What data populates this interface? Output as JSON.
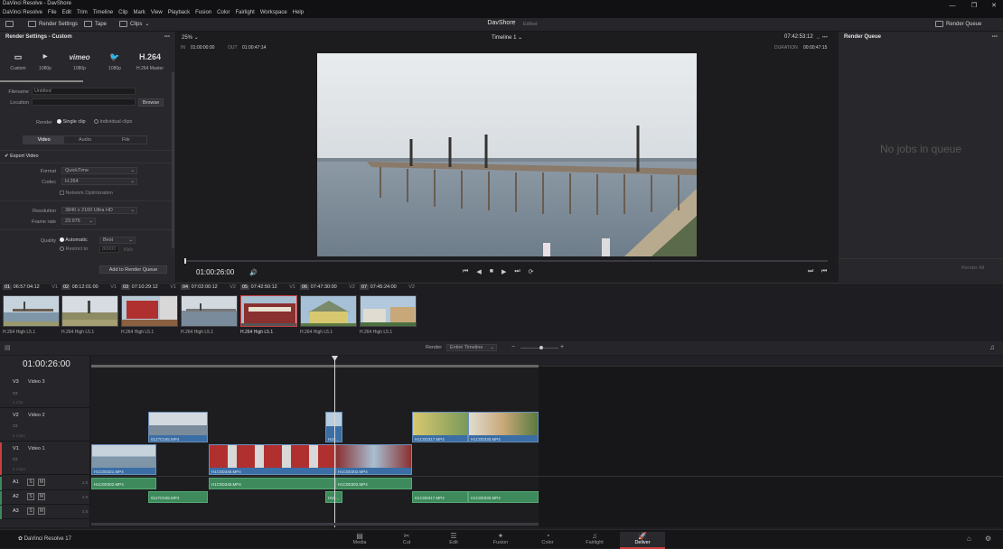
{
  "app": {
    "title": "DaVinci Resolve - DavShore",
    "menus": [
      "DaVinci Resolve",
      "File",
      "Edit",
      "Trim",
      "Timeline",
      "Clip",
      "Mark",
      "View",
      "Playback",
      "Fusion",
      "Color",
      "Fairlight",
      "Workspace",
      "Help"
    ]
  },
  "toolbar": {
    "render_settings": "Render Settings",
    "tape": "Tape",
    "clips": "Clips",
    "project": "DavShore",
    "edited": "Edited",
    "render_queue": "Render Queue"
  },
  "render_settings": {
    "title": "Render Settings - Custom",
    "more": "•••",
    "presets": [
      {
        "icon": "▭",
        "label": "Custom"
      },
      {
        "icon": "▶",
        "label": "1080p"
      },
      {
        "icon": "vimeo",
        "label": "1080p"
      },
      {
        "icon": "🐦",
        "label": "1080p"
      },
      {
        "icon": "H.264",
        "label": "H.264 Master"
      }
    ],
    "filename_label": "Filename",
    "filename": "Untitled",
    "location_label": "Location",
    "browse": "Browse",
    "render_label": "Render",
    "single_clip": "Single clip",
    "individual_clips": "Individual clips",
    "tabs": [
      "Video",
      "Audio",
      "File"
    ],
    "export_video": "Export Video",
    "format_label": "Format",
    "format": "QuickTime",
    "codec_label": "Codec",
    "codec": "H.264",
    "network_opt": "Network Optimization",
    "resolution_label": "Resolution",
    "resolution": "3840 x 2160 Ultra HD",
    "framerate_label": "Frame rate",
    "framerate": "23.976",
    "quality_label": "Quality",
    "automatic": "Automatic",
    "best": "Best",
    "restrict": "Restrict to",
    "restrict_val": "80000",
    "kbs": "Kb/s",
    "add_queue": "Add to Render Queue"
  },
  "viewer": {
    "zoom": "25%",
    "timeline": "Timeline 1",
    "timecode_top": "07:42:53:12",
    "in_label": "IN",
    "in": "01:00:00:00",
    "out_label": "OUT",
    "out": "01:00:47:14",
    "duration_label": "DURATION",
    "duration": "00:00:47:15",
    "timecode": "01:00:26:00"
  },
  "render_queue": {
    "title": "Render Queue",
    "empty": "No jobs in queue",
    "render_all": "Render All"
  },
  "clips": [
    {
      "num": "01",
      "tc": "06:57:04:12",
      "track": "V1",
      "name": "H.264 High L5.1"
    },
    {
      "num": "02",
      "tc": "08:12:01:00",
      "track": "V1",
      "name": "H.264 High L5.1"
    },
    {
      "num": "03",
      "tc": "07:10:29:12",
      "track": "V1",
      "name": "H.264 High L5.1"
    },
    {
      "num": "04",
      "tc": "07:02:00:12",
      "track": "V2",
      "name": "H.264 High L5.1"
    },
    {
      "num": "05",
      "tc": "07:42:50:12",
      "track": "V1",
      "name": "H.264 High L5.1"
    },
    {
      "num": "06",
      "tc": "07:47:30:00",
      "track": "V2",
      "name": "H.264 High L5.1"
    },
    {
      "num": "07",
      "tc": "07:45:24:00",
      "track": "V2",
      "name": "H.264 High L5.1"
    }
  ],
  "timeline": {
    "render_label": "Render",
    "render_value": "Entire Timeline",
    "timecode": "01:00:26:00",
    "tracks": [
      {
        "id": "V3",
        "name": "Video 3",
        "info": "0 Clip"
      },
      {
        "id": "V2",
        "name": "Video 2",
        "info": "5 Clips"
      },
      {
        "id": "V1",
        "name": "Video 1",
        "info": "5 Clips"
      }
    ],
    "audio": [
      {
        "id": "A1",
        "s": "S",
        "m": "M",
        "ch": "2.0"
      },
      {
        "id": "A2",
        "s": "S",
        "m": "M",
        "ch": "2.0"
      },
      {
        "id": "A3",
        "s": "S",
        "m": "M",
        "ch": "2.0"
      }
    ],
    "v2clips": [
      "0127C045.MP4",
      "H10...",
      "H1C0D317.MP4",
      "H1C0D330.MP4"
    ],
    "v1clips": [
      "H1C0D321.MP4",
      "H1C0D348.MP4",
      "H1C0D302.MP4"
    ],
    "a1clips": [
      "H1C0D302.MP4",
      "H1C0D348.MP4",
      "H1C0D302.MP4"
    ],
    "a2clips": [
      "0127C045.MP4",
      "H10...",
      "H1C0D317.MP4",
      "H1C0D330.MP4"
    ]
  },
  "bottom": {
    "version": "DaVinci Resolve 17",
    "pages": [
      {
        "icon": "▤",
        "label": "Media"
      },
      {
        "icon": "✂",
        "label": "Cut"
      },
      {
        "icon": "☰",
        "label": "Edit"
      },
      {
        "icon": "✦",
        "label": "Fusion"
      },
      {
        "icon": "◔",
        "label": "Color"
      },
      {
        "icon": "♫",
        "label": "Fairlight"
      },
      {
        "icon": "🚀",
        "label": "Deliver"
      }
    ]
  }
}
